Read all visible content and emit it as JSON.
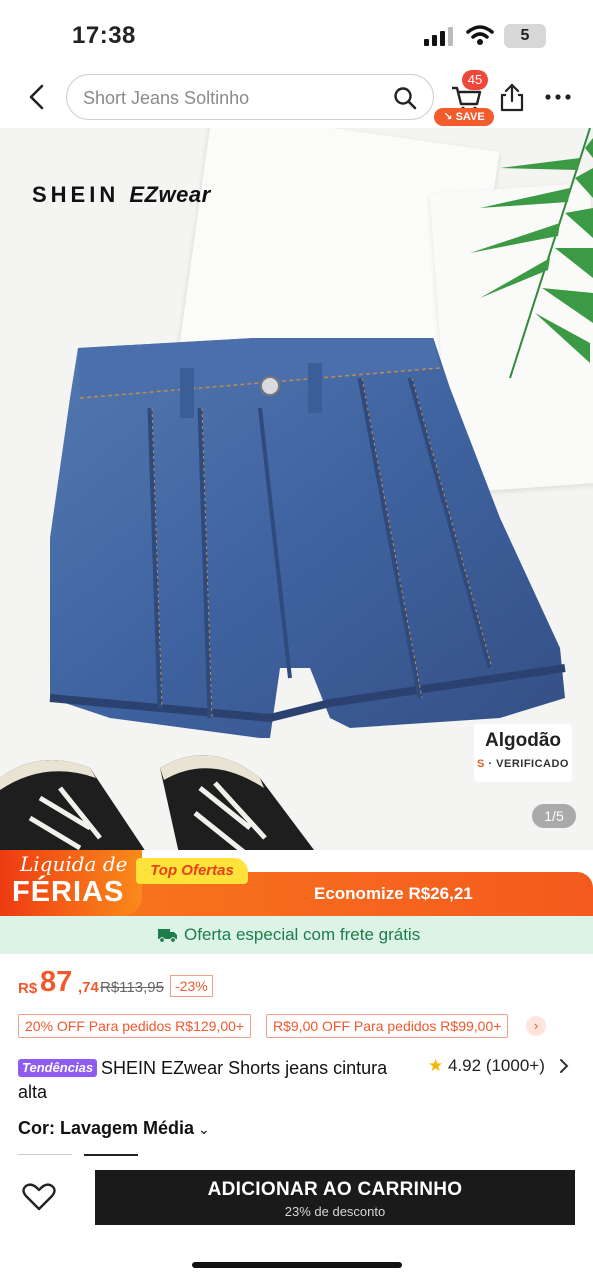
{
  "status_bar": {
    "time": "17:38",
    "battery": "5"
  },
  "header": {
    "search_placeholder": "Short Jeans Soltinho",
    "cart_count": "45",
    "save_label": "SAVE"
  },
  "hero": {
    "brand_main": "SHEIN",
    "brand_sub": "EZwear",
    "badge_title": "Algodão",
    "badge_sub_prefix": "S",
    "badge_sub": "VERIFICADO",
    "pager": "1/5"
  },
  "promo": {
    "liquida": "Liquida de",
    "ferias": "FÉRIAS",
    "top_ofertas": "Top Ofertas",
    "economize": "Economize R$26,21"
  },
  "frete": {
    "text": "Oferta especial com frete grátis"
  },
  "price": {
    "currency": "R$",
    "integer": "87",
    "decimal": ",74",
    "old": "R$113,95",
    "discount": "-23%"
  },
  "coupons": [
    "20% OFF Para pedidos R$129,00+",
    "R$9,00 OFF Para pedidos R$99,00+"
  ],
  "product": {
    "tag": "Tendências",
    "title": "SHEIN EZwear Shorts jeans cintura alta",
    "rating": "4.92",
    "reviews": "(1000+)"
  },
  "color": {
    "label": "Cor: Lavagem Média"
  },
  "bottom": {
    "add_to_cart": "ADICIONAR AO CARRINHO",
    "discount_note": "23% de desconto"
  },
  "colors": {
    "accent": "#f0582d",
    "promo_orange": "#f8731d",
    "frete_bg": "#dcf3e6",
    "frete_text": "#1e7d4c",
    "tag_purple": "#8e5cf2"
  },
  "icons": [
    "back-icon",
    "search-icon",
    "cart-icon",
    "share-icon",
    "more-icon",
    "truck-icon",
    "star-icon",
    "chevron-right-icon",
    "chevron-down-icon",
    "heart-icon"
  ]
}
